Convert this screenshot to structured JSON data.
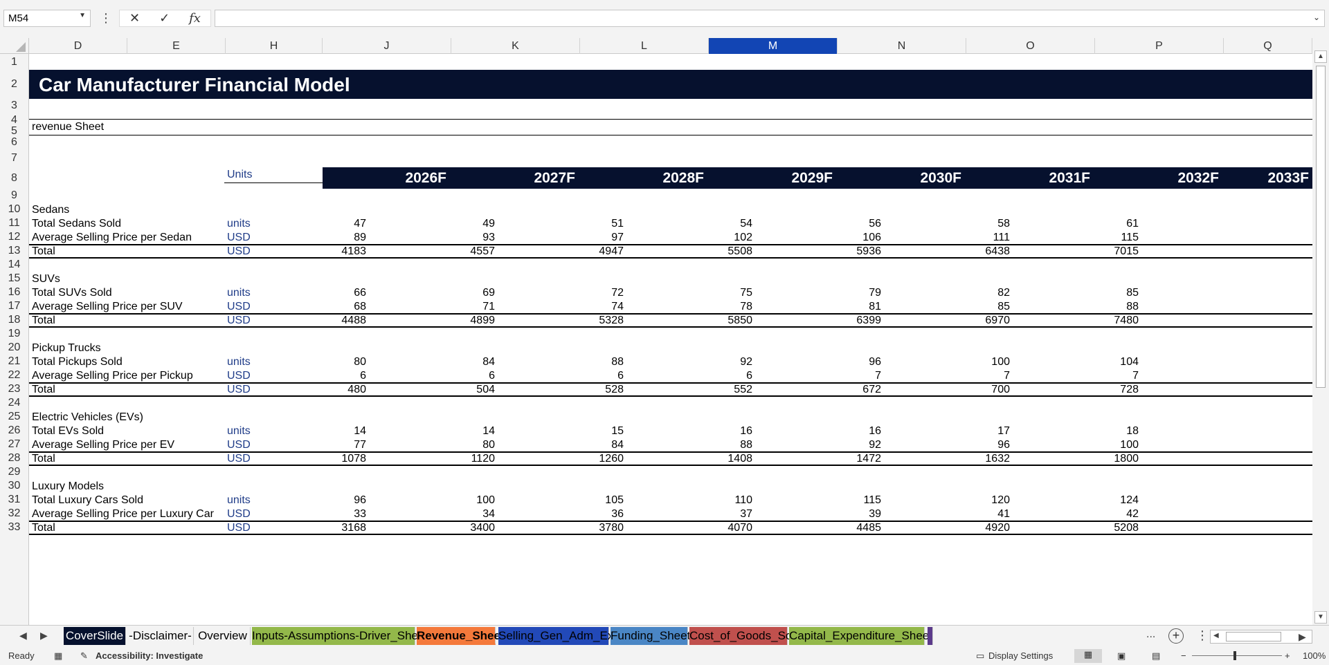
{
  "formula_bar": {
    "name_box": "M54",
    "cancel_icon": "✕",
    "enter_icon": "✓",
    "fx_label": "fx",
    "formula": ""
  },
  "columns": [
    "D",
    "E",
    "H",
    "J",
    "K",
    "L",
    "M",
    "N",
    "O",
    "P",
    "Q"
  ],
  "selected_column": "M",
  "rows": [
    "1",
    "2",
    "3",
    "4",
    "5",
    "6",
    "7",
    "8",
    "9",
    "10",
    "11",
    "12",
    "13",
    "14",
    "15",
    "16",
    "17",
    "18",
    "19",
    "20",
    "21",
    "22",
    "23",
    "24",
    "25",
    "26",
    "27",
    "28",
    "29",
    "30",
    "31",
    "32",
    "33"
  ],
  "sheet": {
    "title": "Car Manufacturer Financial Model",
    "subtitle": "revenue Sheet",
    "units_header": "Units",
    "years": [
      "2026F",
      "2027F",
      "2028F",
      "2029F",
      "2030F",
      "2031F",
      "2032F",
      "2033F"
    ],
    "sections": [
      {
        "name": "Sedans",
        "rows": [
          {
            "label": "Total Sedans Sold",
            "unit": "units",
            "values": [
              "47",
              "49",
              "51",
              "54",
              "56",
              "58",
              "61"
            ]
          },
          {
            "label": "Average Selling Price per Sedan",
            "unit": "USD",
            "values": [
              "89",
              "93",
              "97",
              "102",
              "106",
              "111",
              "115"
            ]
          },
          {
            "label": "Total",
            "unit": "USD",
            "values": [
              "4183",
              "4557",
              "4947",
              "5508",
              "5936",
              "6438",
              "7015"
            ]
          }
        ]
      },
      {
        "name": "SUVs",
        "rows": [
          {
            "label": "Total SUVs Sold",
            "unit": "units",
            "values": [
              "66",
              "69",
              "72",
              "75",
              "79",
              "82",
              "85"
            ]
          },
          {
            "label": "Average Selling Price per SUV",
            "unit": "USD",
            "values": [
              "68",
              "71",
              "74",
              "78",
              "81",
              "85",
              "88"
            ]
          },
          {
            "label": "Total",
            "unit": "USD",
            "values": [
              "4488",
              "4899",
              "5328",
              "5850",
              "6399",
              "6970",
              "7480"
            ]
          }
        ]
      },
      {
        "name": "Pickup Trucks",
        "rows": [
          {
            "label": "Total Pickups Sold",
            "unit": "units",
            "values": [
              "80",
              "84",
              "88",
              "92",
              "96",
              "100",
              "104"
            ]
          },
          {
            "label": "Average Selling Price per Pickup",
            "unit": "USD",
            "values": [
              "6",
              "6",
              "6",
              "6",
              "7",
              "7",
              "7"
            ]
          },
          {
            "label": "Total",
            "unit": "USD",
            "values": [
              "480",
              "504",
              "528",
              "552",
              "672",
              "700",
              "728"
            ]
          }
        ]
      },
      {
        "name": "Electric Vehicles (EVs)",
        "rows": [
          {
            "label": "Total EVs Sold",
            "unit": "units",
            "values": [
              "14",
              "14",
              "15",
              "16",
              "16",
              "17",
              "18"
            ]
          },
          {
            "label": "Average Selling Price per EV",
            "unit": "USD",
            "values": [
              "77",
              "80",
              "84",
              "88",
              "92",
              "96",
              "100"
            ]
          },
          {
            "label": "Total",
            "unit": "USD",
            "values": [
              "1078",
              "1120",
              "1260",
              "1408",
              "1472",
              "1632",
              "1800"
            ]
          }
        ]
      },
      {
        "name": "Luxury Models",
        "rows": [
          {
            "label": "Total Luxury Cars Sold",
            "unit": "units",
            "values": [
              "96",
              "100",
              "105",
              "110",
              "115",
              "120",
              "124"
            ]
          },
          {
            "label": "Average Selling Price per Luxury Car",
            "unit": "USD",
            "values": [
              "33",
              "34",
              "36",
              "37",
              "39",
              "41",
              "42"
            ]
          },
          {
            "label": "Total",
            "unit": "USD",
            "values": [
              "3168",
              "3400",
              "3780",
              "4070",
              "4485",
              "4920",
              "5208"
            ]
          }
        ]
      }
    ]
  },
  "tabs": [
    {
      "label": "CoverSlide",
      "bg": "#06112e",
      "fg": "#ffffff",
      "active": false
    },
    {
      "label": "-Disclaimer-",
      "bg": "#f3f3f3",
      "fg": "#000000",
      "active": false
    },
    {
      "label": "Overview",
      "bg": "#f3f3f3",
      "fg": "#000000",
      "active": false
    },
    {
      "label": "Inputs-Assumptions-Driver_Sheet",
      "bg": "#93b84a",
      "fg": "#000000",
      "active": false
    },
    {
      "label": "Revenue_Sheet",
      "bg": "#ffffff",
      "fg": "#000000",
      "active": true
    },
    {
      "label": "Selling_Gen_Adm_Exp",
      "bg": "#2249b8",
      "fg": "#000000",
      "active": false
    },
    {
      "label": "Funding_Sheet",
      "bg": "#4a86c5",
      "fg": "#000000",
      "active": false
    },
    {
      "label": "Cost_of_Goods_Sold",
      "bg": "#c0504d",
      "fg": "#000000",
      "active": false
    },
    {
      "label": "Capital_Expenditure_Sheet",
      "bg": "#93b84a",
      "fg": "#000000",
      "active": false
    }
  ],
  "tab_overflow": "...",
  "status": {
    "ready": "Ready",
    "accessibility": "Accessibility: Investigate",
    "display_settings": "Display Settings",
    "zoom": "100%"
  },
  "colors": {
    "navy": "#06112e",
    "unit_blue": "#1f3c88",
    "selected_col": "#1245b4",
    "active_tab_accent": "#f4793b"
  }
}
